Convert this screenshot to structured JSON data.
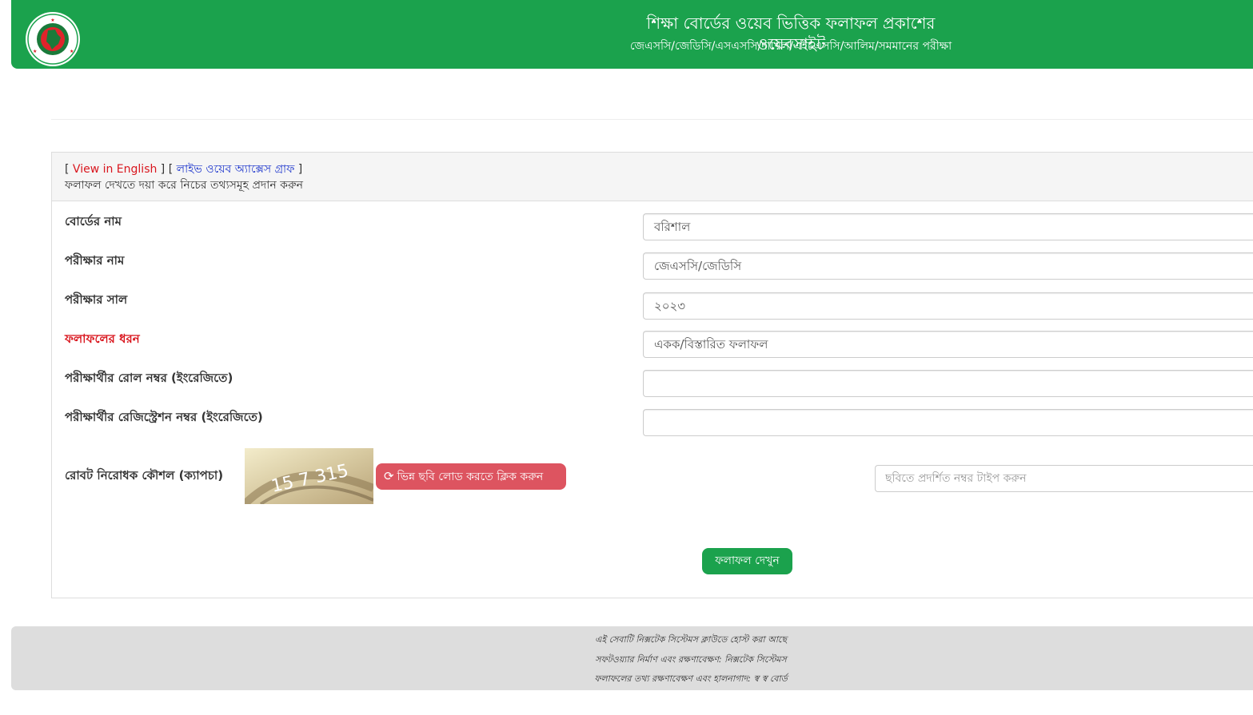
{
  "header": {
    "title": "শিক্ষা বোর্ডের ওয়েব ভিত্তিক ফলাফল প্রকাশের ওয়েবসাইট",
    "subtitle": "জেএসসি/জেডিসি/এসএসসি/দাখিল/এইচএসসি/আলিম/সমমানের পরীক্ষা",
    "logo_text_top": "গণপ্রজাতন্ত্রী বাংলাদেশ",
    "logo_text_bottom": "সরকার"
  },
  "panel_heading": {
    "bracket_open_1": "[ ",
    "view_in_english": "View in English",
    "bracket_close_open": " ] [ ",
    "live_graph": "লাইভ ওয়েব অ্যাক্সেস গ্রাফ",
    "bracket_close_2": " ]",
    "instruction": "ফলাফল দেখতে দয়া করে নিচের তথ্যসমূহ প্রদান করুন"
  },
  "form": {
    "board": {
      "label": "বোর্ডের নাম",
      "value": "বরিশাল"
    },
    "exam": {
      "label": "পরীক্ষার নাম",
      "value": "জেএসসি/জেডিসি"
    },
    "year": {
      "label": "পরীক্ষার সাল",
      "value": "২০২৩"
    },
    "result_type": {
      "label": "ফলাফলের ধরন",
      "value": "একক/বিস্তারিত ফলাফল"
    },
    "roll": {
      "label": "পরীক্ষার্থীর রোল নম্বর (ইংরেজিতে)",
      "value": ""
    },
    "registration": {
      "label": "পরীক্ষার্থীর রেজিস্ট্রেশন নম্বর (ইংরেজিতে)",
      "value": ""
    },
    "captcha": {
      "label": "রোবট নিরোধক কৌশল (ক্যাপচা)",
      "image_text": "15 7 315",
      "reload_label": "ভিন্ন ছবি লোড করতে ক্লিক করুন",
      "placeholder": "ছবিতে প্রদর্শিত নম্বর টাইপ করুন"
    },
    "submit_label": "ফলাফল দেখুন"
  },
  "footer": {
    "line1": "এই সেবাটি নিক্সটেক সিস্টেমস ক্লাউডে হোস্ট করা আছে",
    "line2": "সফটওয়্যার নির্মাণ এবং রক্ষণাবেক্ষণ: নিক্সটেক সিস্টেমস",
    "line3": "ফলাফলের তথ্য রক্ষণাবেক্ষণ এবং হালনাগাদ: স্ব স্ব বোর্ড"
  },
  "colors": {
    "brand_green": "#1ba24d",
    "danger_red": "#dd5460",
    "link_red": "#d9161e",
    "link_blue": "#1a33cc"
  }
}
